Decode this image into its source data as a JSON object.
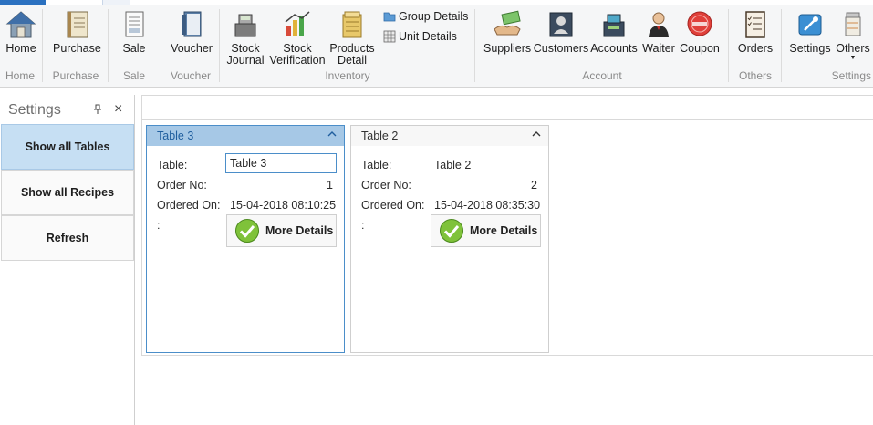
{
  "ribbon": {
    "groups": {
      "home": {
        "label": "Home",
        "buttons": {
          "home": "Home"
        }
      },
      "purchase": {
        "label": "Purchase",
        "buttons": {
          "purchase": "Purchase"
        }
      },
      "sale": {
        "label": "Sale",
        "buttons": {
          "sale": "Sale"
        }
      },
      "voucher": {
        "label": "Voucher",
        "buttons": {
          "voucher": "Voucher"
        }
      },
      "inventory": {
        "label": "Inventory",
        "buttons": {
          "stock_journal_1": "Stock",
          "stock_journal_2": "Journal",
          "stock_verification_1": "Stock",
          "stock_verification_2": "Verification",
          "products_detail_1": "Products",
          "products_detail_2": "Detail",
          "group_details": "Group Details",
          "unit_details": "Unit Details"
        }
      },
      "account": {
        "label": "Account",
        "buttons": {
          "suppliers": "Suppliers",
          "customers": "Customers",
          "accounts": "Accounts",
          "waiter": "Waiter",
          "coupon": "Coupon"
        }
      },
      "others": {
        "label": "Others",
        "buttons": {
          "orders": "Orders"
        }
      },
      "settings": {
        "label": "Settings",
        "buttons": {
          "settings": "Settings",
          "others": "Others"
        }
      }
    }
  },
  "settings_panel": {
    "title": "Settings",
    "buttons": {
      "show_all_tables": "Show all Tables",
      "show_all_recipes": "Show all Recipes",
      "refresh": "Refresh"
    }
  },
  "cards": {
    "table3": {
      "header": "Table 3",
      "table_label": "Table:",
      "table_value": "Table 3",
      "order_label": "Order No:",
      "order_value": "1",
      "ordered_label": "Ordered On:",
      "ordered_value": "15-04-2018 08:10:25",
      "colon": ":",
      "more": "More Details"
    },
    "table2": {
      "header": "Table 2",
      "table_label": "Table:",
      "table_value": "Table 2",
      "order_label": "Order No:",
      "order_value": "2",
      "ordered_label": "Ordered On:",
      "ordered_value": "15-04-2018 08:35:30",
      "colon": ":",
      "more": "More Details"
    }
  },
  "colors": {
    "accent": "#4b8ec9",
    "selected_header": "#a6c8e6",
    "active_panel_button": "#c6dff3"
  }
}
